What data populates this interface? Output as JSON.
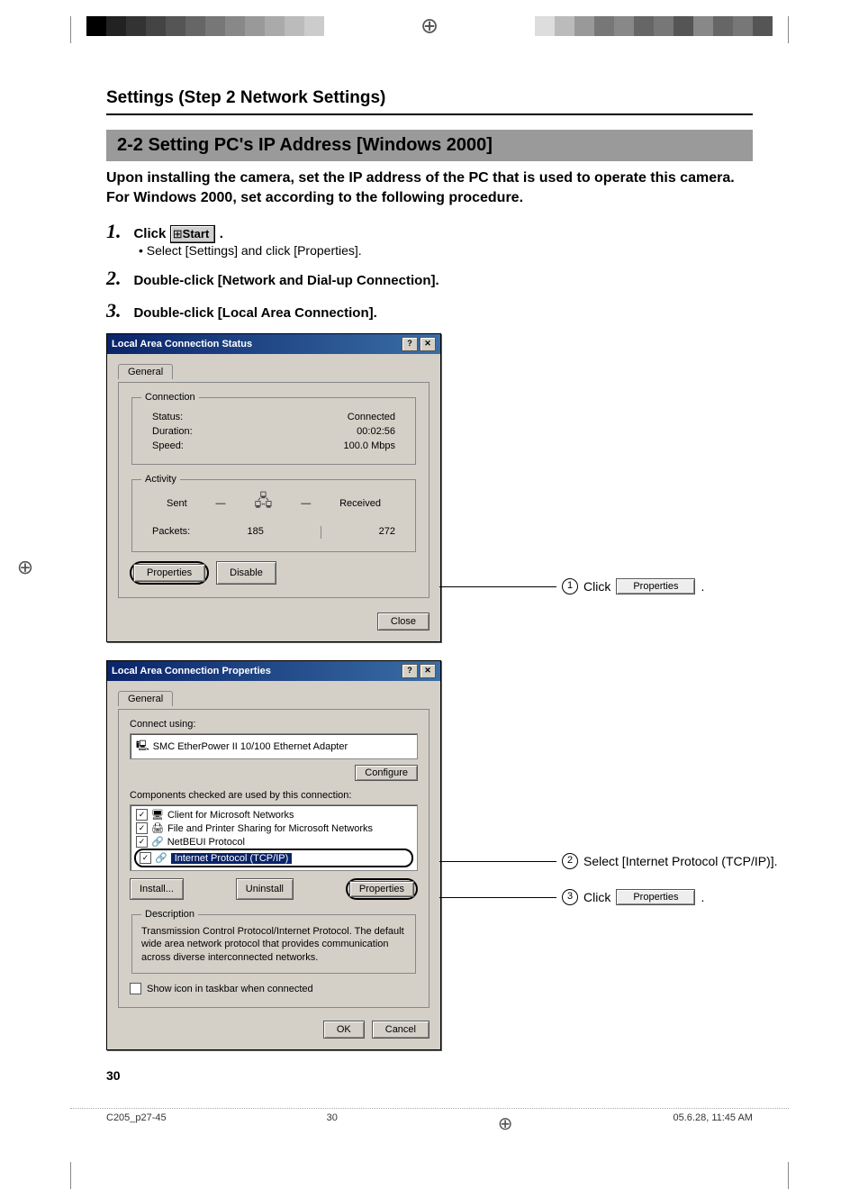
{
  "header": {
    "title": "Settings (Step 2 Network Settings)"
  },
  "section": {
    "title": "2-2 Setting PC's IP Address [Windows 2000]",
    "intro": "Upon installing the camera, set the IP address of the PC that is used to operate this camera. For Windows 2000, set according to the following procedure."
  },
  "steps": {
    "s1_num": "1.",
    "s1_text": "Click",
    "s1_after": ".",
    "start_label": "Start",
    "s1_sub": "• Select [Settings] and click [Properties].",
    "s2_num": "2.",
    "s2_text": "Double-click [Network and Dial-up Connection].",
    "s3_num": "3.",
    "s3_text": "Double-click [Local Area Connection]."
  },
  "dialog1": {
    "title": "Local Area Connection Status",
    "tab": "General",
    "conn_legend": "Connection",
    "status_label": "Status:",
    "status_value": "Connected",
    "duration_label": "Duration:",
    "duration_value": "00:02:56",
    "speed_label": "Speed:",
    "speed_value": "100.0 Mbps",
    "activity_legend": "Activity",
    "sent_label": "Sent",
    "received_label": "Received",
    "packets_label": "Packets:",
    "packets_sent": "185",
    "packets_recv": "272",
    "properties_btn": "Properties",
    "disable_btn": "Disable",
    "close_btn": "Close"
  },
  "callouts": {
    "c1_num": "1",
    "c1_text": "Click",
    "c1_btn": "Properties",
    "c1_dot": ".",
    "c2_num": "2",
    "c2_text": "Select [Internet Protocol (TCP/IP)].",
    "c3_num": "3",
    "c3_text": "Click",
    "c3_btn": "Properties",
    "c3_dot": "."
  },
  "dialog2": {
    "title": "Local Area Connection Properties",
    "tab": "General",
    "connect_using_label": "Connect using:",
    "adapter": "SMC EtherPower II 10/100 Ethernet Adapter",
    "configure_btn": "Configure",
    "components_label": "Components checked are used by this connection:",
    "items": {
      "i1": "Client for Microsoft Networks",
      "i2": "File and Printer Sharing for Microsoft Networks",
      "i3": "NetBEUI Protocol",
      "i4": "Internet Protocol (TCP/IP)"
    },
    "install_btn": "Install...",
    "uninstall_btn": "Uninstall",
    "properties_btn": "Properties",
    "desc_legend": "Description",
    "desc_text": "Transmission Control Protocol/Internet Protocol. The default wide area network protocol that provides communication across diverse interconnected networks.",
    "show_icon": "Show icon in taskbar when connected",
    "ok_btn": "OK",
    "cancel_btn": "Cancel"
  },
  "footer": {
    "page_num": "30",
    "file": "C205_p27-45",
    "pg": "30",
    "date": "05.6.28, 11:45 AM"
  }
}
